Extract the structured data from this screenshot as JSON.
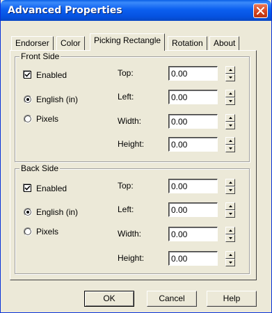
{
  "window": {
    "title": "Advanced Properties"
  },
  "tabs": [
    {
      "label": "Endorser"
    },
    {
      "label": "Color"
    },
    {
      "label": "Picking Rectangle",
      "selected": true
    },
    {
      "label": "Rotation"
    },
    {
      "label": "About"
    }
  ],
  "front": {
    "title": "Front Side",
    "enabled_label": "Enabled",
    "enabled_checked": true,
    "unit_english_label": "English (in)",
    "unit_pixels_label": "Pixels",
    "selected_unit": "english",
    "top_label": "Top:",
    "top_value": "0.00",
    "left_label": "Left:",
    "left_value": "0.00",
    "width_label": "Width:",
    "width_value": "0.00",
    "height_label": "Height:",
    "height_value": "0.00"
  },
  "back": {
    "title": "Back Side",
    "enabled_label": "Enabled",
    "enabled_checked": true,
    "unit_english_label": "English (in)",
    "unit_pixels_label": "Pixels",
    "selected_unit": "english",
    "top_label": "Top:",
    "top_value": "0.00",
    "left_label": "Left:",
    "left_value": "0.00",
    "width_label": "Width:",
    "width_value": "0.00",
    "height_label": "Height:",
    "height_value": "0.00"
  },
  "buttons": {
    "ok": "OK",
    "cancel": "Cancel",
    "help": "Help"
  },
  "icons": {
    "close": "close-icon",
    "check": "checkmark-icon",
    "spin_up": "arrow-up-icon",
    "spin_down": "arrow-down-icon"
  },
  "colors": {
    "titlebar": "#0552e0",
    "dialog_face": "#ece9d8",
    "close_button": "#d3421b"
  }
}
